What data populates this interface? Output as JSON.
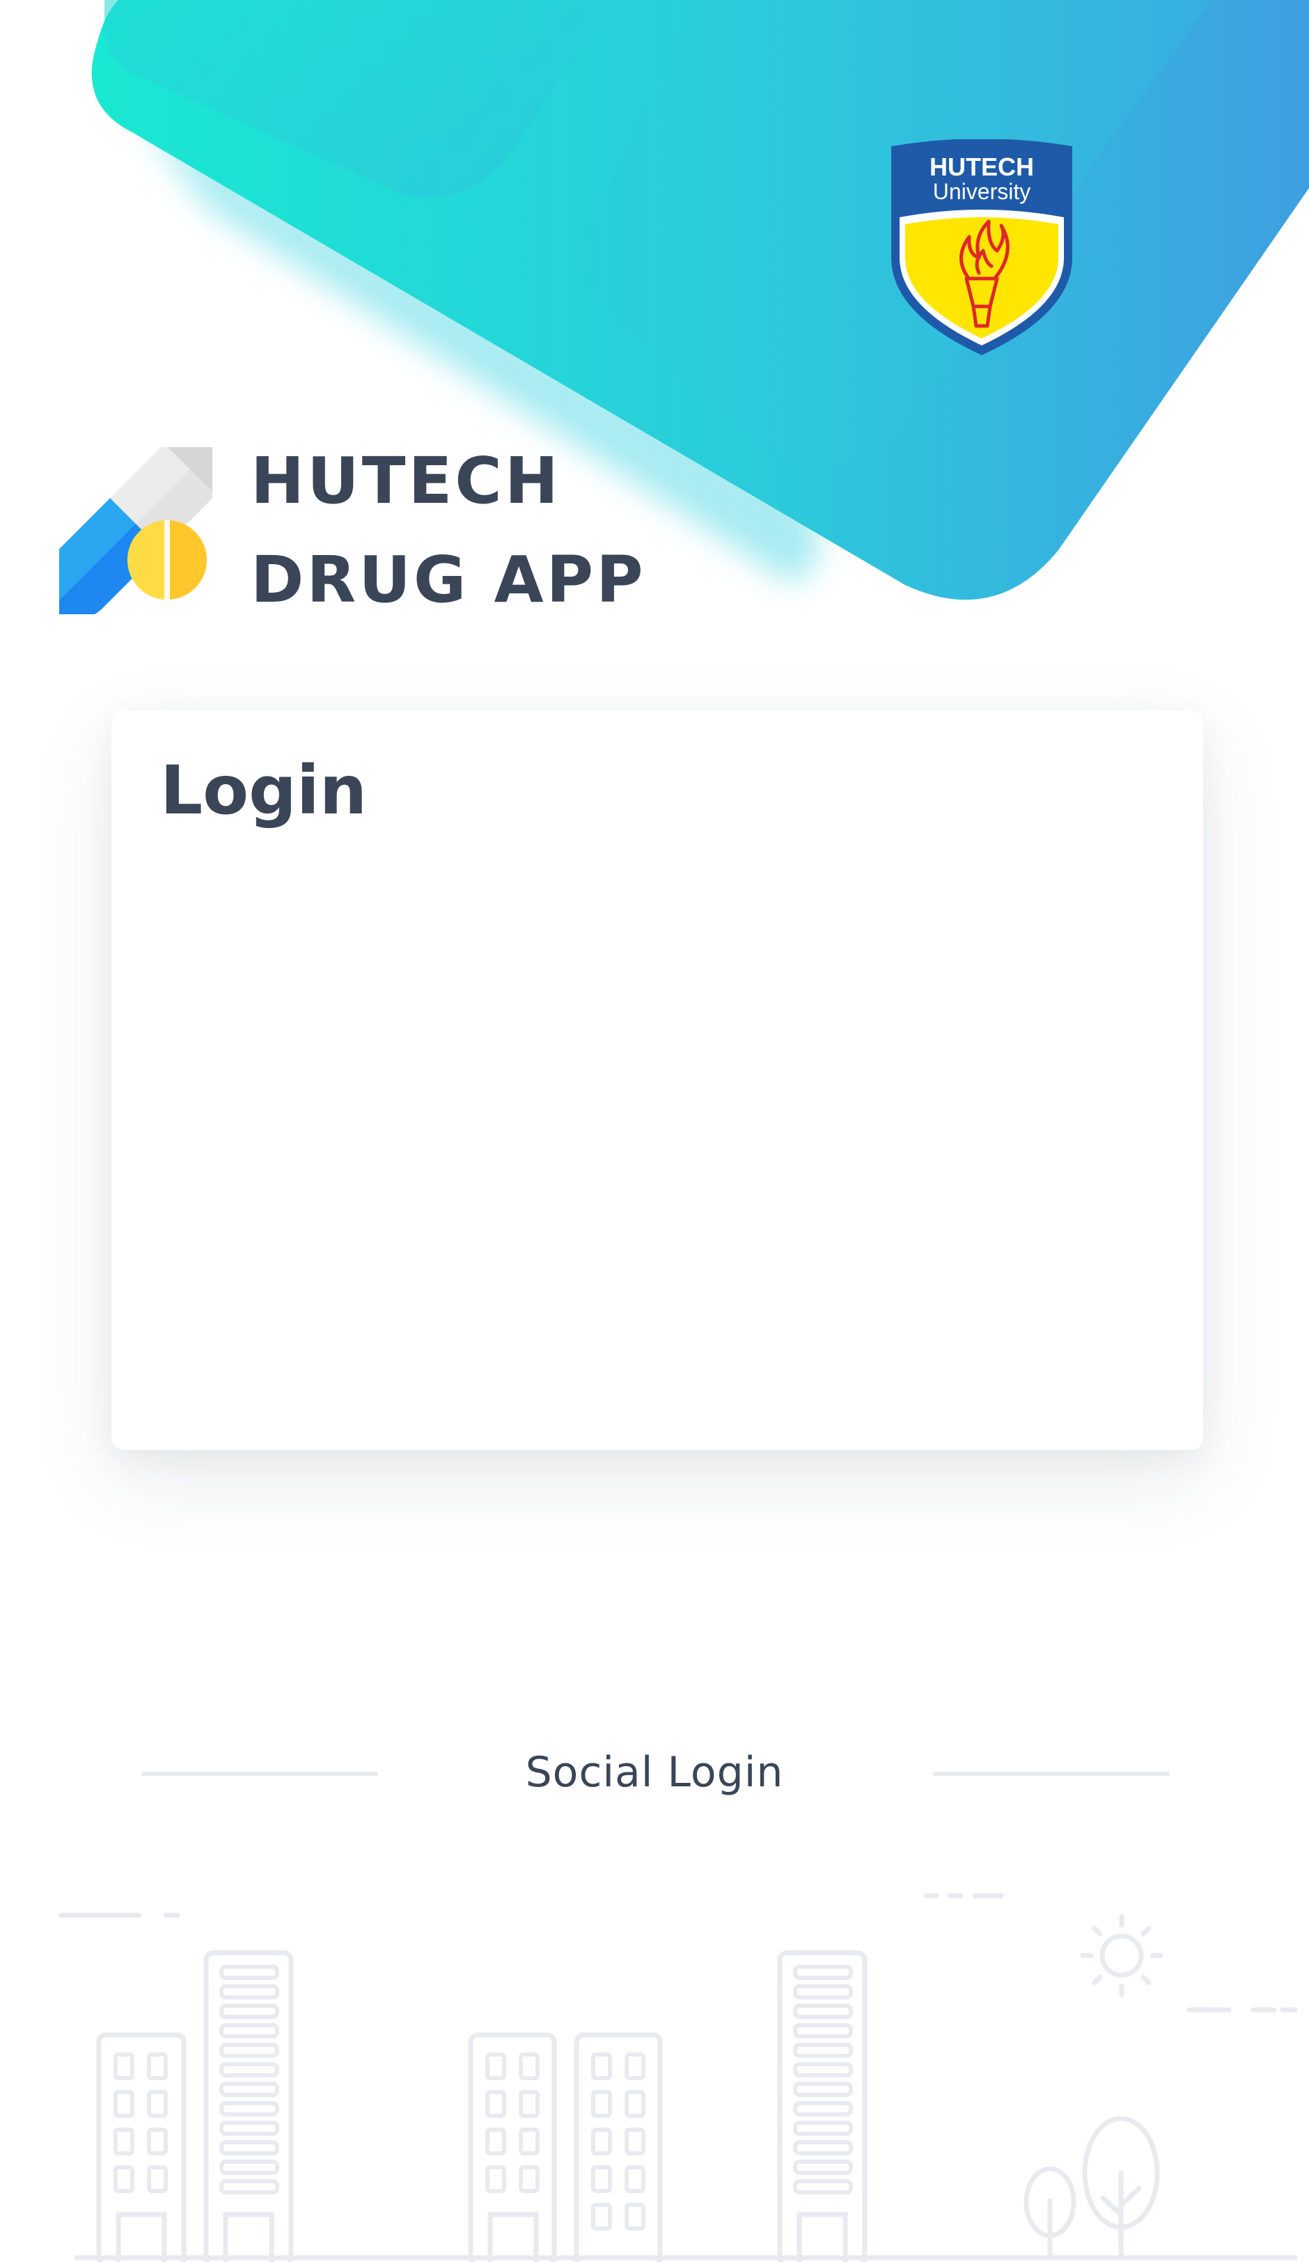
{
  "brand": {
    "line1": "HUTECH",
    "line2": "DRUG APP",
    "logo_icon": "pill-capsule-icon"
  },
  "crest": {
    "line1": "HUTECH",
    "line2": "University",
    "icon": "torch-icon"
  },
  "login": {
    "title": "Login"
  },
  "social": {
    "label": "Social Login"
  },
  "colors": {
    "gradient_start": "#19e8d2",
    "gradient_end": "#3e9fe0",
    "text_dark": "#3a4558",
    "crest_blue": "#1f5aa8",
    "crest_yellow": "#ffe600",
    "torch_red": "#e0262a",
    "pill_blue": "#1e88f0",
    "pill_gray": "#e2e2e2",
    "pill_yellow": "#ffc72c"
  }
}
